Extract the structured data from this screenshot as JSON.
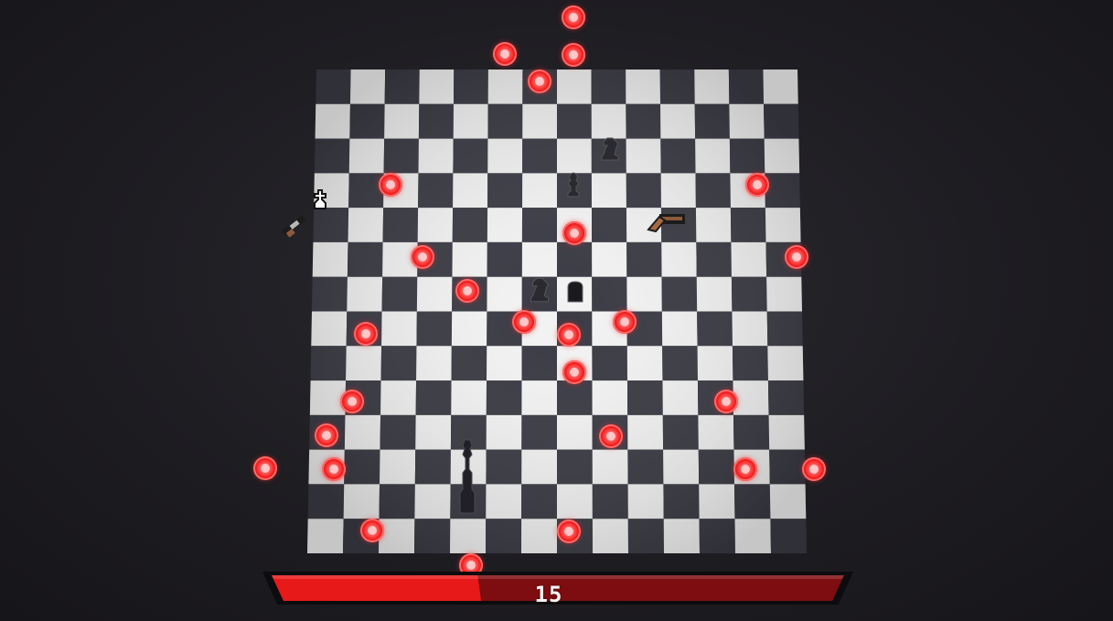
{
  "score": "15",
  "health": 0.36,
  "colors": {
    "light_square": "#f2f2f2",
    "dark_square": "#3a3a44",
    "bullet": "#ff2a2a",
    "health_fill": "#e81919",
    "health_empty": "#7d0d10"
  },
  "board": {
    "rows": 14,
    "cols": 14
  },
  "pieces": [
    {
      "kind": "knight",
      "icon": "knight-icon"
    },
    {
      "kind": "pawn",
      "icon": "pawn-icon"
    },
    {
      "kind": "knight",
      "icon": "knight-icon"
    },
    {
      "kind": "rook",
      "icon": "rook-icon"
    },
    {
      "kind": "bishop",
      "icon": "bishop-icon"
    },
    {
      "kind": "player-king",
      "icon": "king-icon"
    },
    {
      "kind": "shotgun",
      "icon": "shotgun-icon"
    },
    {
      "kind": "shotgun-pickup",
      "icon": "shotgun-icon"
    }
  ]
}
